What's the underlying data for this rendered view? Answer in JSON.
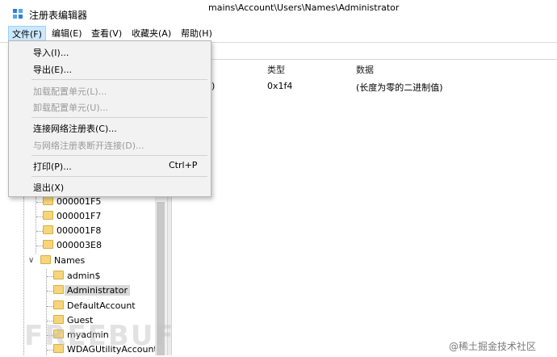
{
  "window": {
    "title": "注册表编辑器"
  },
  "menubar": {
    "file": "文件(F)",
    "edit": "编辑(E)",
    "view": "查看(V)",
    "favorites": "收藏夹(A)",
    "help": "帮助(H)"
  },
  "address": {
    "path": "mains\\Account\\Users\\Names\\Administrator"
  },
  "file_menu": {
    "import": "导入(I)...",
    "export": "导出(E)...",
    "load_hive": "加载配置单元(L)...",
    "unload_hive": "卸载配置单元(U)...",
    "connect_network": "连接网络注册表(C)...",
    "disconnect_network": "与网络注册表断开连接(D)...",
    "print": "打印(P)...",
    "print_shortcut": "Ctrl+P",
    "exit": "退出(X)"
  },
  "values": {
    "headers": {
      "type": "类型",
      "data": "数据"
    },
    "row": {
      "name_tail": ")",
      "type": "0x1f4",
      "data": "(长度为零的二进制值)"
    }
  },
  "tree": {
    "items": [
      "000001F5",
      "000001F7",
      "000001F8",
      "000003E8"
    ],
    "names_label": "Names",
    "names_children": [
      "admin$",
      "Administrator",
      "DefaultAccount",
      "Guest",
      "myadmin",
      "WDAGUtilityAccount"
    ]
  },
  "watermark": {
    "left": "FREEBUF",
    "right": "@稀土掘金技术社区"
  }
}
